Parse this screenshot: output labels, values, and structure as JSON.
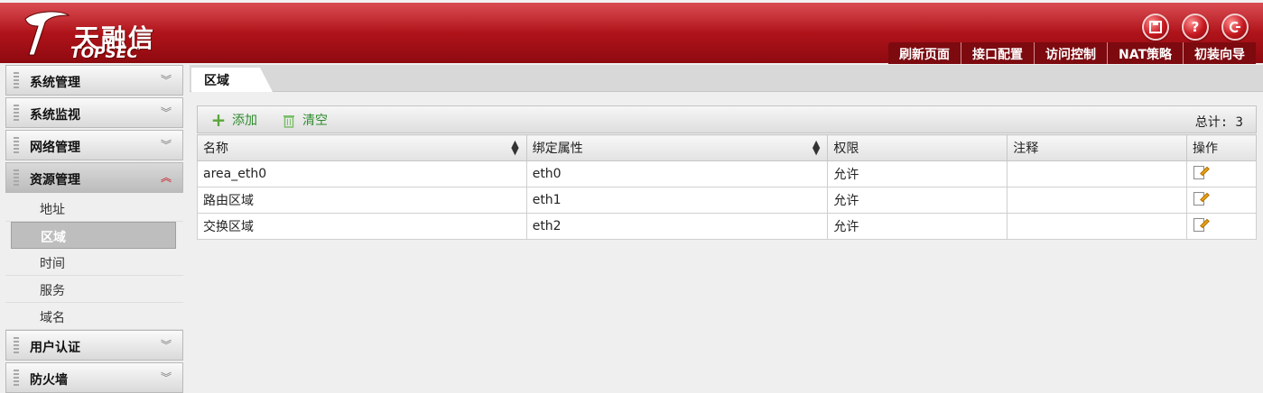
{
  "header": {
    "logo_cn": "天融信",
    "logo_en": "TOPSEC",
    "icons": [
      "save-icon",
      "help-icon",
      "logout-icon"
    ],
    "nav": [
      "刷新页面",
      "接口配置",
      "访问控制",
      "NAT策略",
      "初装向导"
    ]
  },
  "sidebar": {
    "groups": [
      {
        "label": "系统管理"
      },
      {
        "label": "系统监视"
      },
      {
        "label": "网络管理"
      },
      {
        "label": "资源管理"
      },
      {
        "label": "用户认证"
      },
      {
        "label": "防火墙"
      }
    ],
    "resource_items": [
      "地址",
      "区域",
      "时间",
      "服务",
      "域名"
    ]
  },
  "main": {
    "tab": "区域",
    "toolbar": {
      "add": "添加",
      "clear": "清空",
      "total": "总计: 3"
    },
    "columns": [
      "名称",
      "绑定属性",
      "权限",
      "注释",
      "操作"
    ],
    "rows": [
      {
        "name": "area_eth0",
        "bind": "eth0",
        "perm": "允许",
        "note": ""
      },
      {
        "name": "路由区域",
        "bind": "eth1",
        "perm": "允许",
        "note": ""
      },
      {
        "name": "交换区域",
        "bind": "eth2",
        "perm": "允许",
        "note": ""
      }
    ]
  },
  "colors": {
    "header_red": "#b3141b",
    "action_green": "#2e8b2e"
  }
}
